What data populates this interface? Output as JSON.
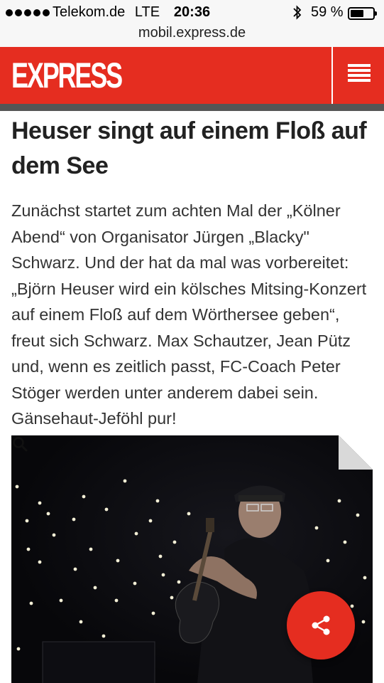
{
  "status_bar": {
    "carrier": "Telekom.de",
    "network": "LTE",
    "time": "20:36",
    "battery_percent": "59 %",
    "battery_level": 0.59,
    "url": "mobil.express.de"
  },
  "header": {
    "logo_text": "EXPRESS",
    "brand_color": "#e52d20",
    "menu_icon": "hamburger-menu-icon"
  },
  "article": {
    "headline": "Heuser singt auf einem Floß auf dem See",
    "body": "Zunächst startet zum achten Mal der „Kölner Abend“ von Organisator Jürgen „Blacky\" Schwarz. Und der hat da mal was vorberei­tet: „Björn Heuser wird ein kölsches Mitsing-Konzert auf einem Floß auf dem Wörthersee geben“, freut sich Schwarz. Max Schautzer, Jean Pütz und, wenn es zeitlich passt, FC-Coach Peter Stöger werden unter anderem dabei sein. Gänsehaut-Jeföhl pur!"
  },
  "photo": {
    "zoom_icon": "magnify-icon",
    "share_icon": "share-icon"
  }
}
